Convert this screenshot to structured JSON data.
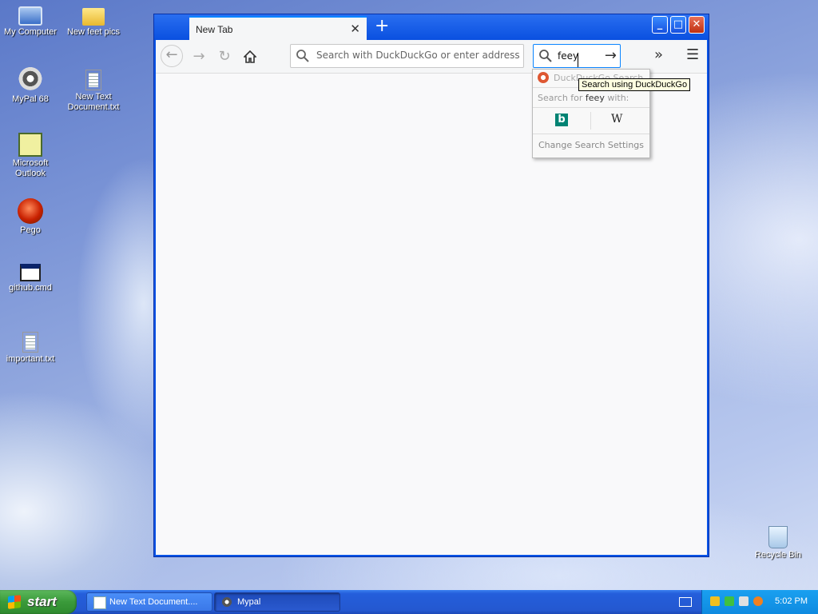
{
  "desktop": {
    "icons": [
      {
        "label": "My Computer"
      },
      {
        "label": "New feet pics"
      },
      {
        "label": "MyPal 68"
      },
      {
        "label": "New Text Document.txt"
      },
      {
        "label": "Microsoft Outlook"
      },
      {
        "label": "Pego"
      },
      {
        "label": "github.cmd"
      },
      {
        "label": "important.txt"
      },
      {
        "label": "Recycle Bin"
      }
    ]
  },
  "browser": {
    "tab_title": "New Tab",
    "new_tab_symbol": "+",
    "window_controls": {
      "minimize": "_",
      "maximize": "□",
      "close": "✕"
    },
    "url_placeholder": "Search with DuckDuckGo or enter address",
    "search_value": "feey",
    "search_dropdown": {
      "engine_name": "DuckDuckGo Search",
      "search_for_prefix": "Search for ",
      "search_for_query": "feey",
      "search_for_suffix": " with:",
      "engines": [
        "b",
        "W"
      ],
      "change_settings": "Change Search Settings"
    },
    "tooltip": "Search using DuckDuckGo"
  },
  "taskbar": {
    "start_label": "start",
    "tasks": [
      {
        "label": "New Text Document...."
      },
      {
        "label": "Mypal"
      }
    ],
    "clock": "5:02 PM"
  },
  "colors": {
    "accent": "#0a84ff",
    "taskbar": "#245edb",
    "start": "#3a9a3a",
    "tray": "#0e8ae0"
  }
}
